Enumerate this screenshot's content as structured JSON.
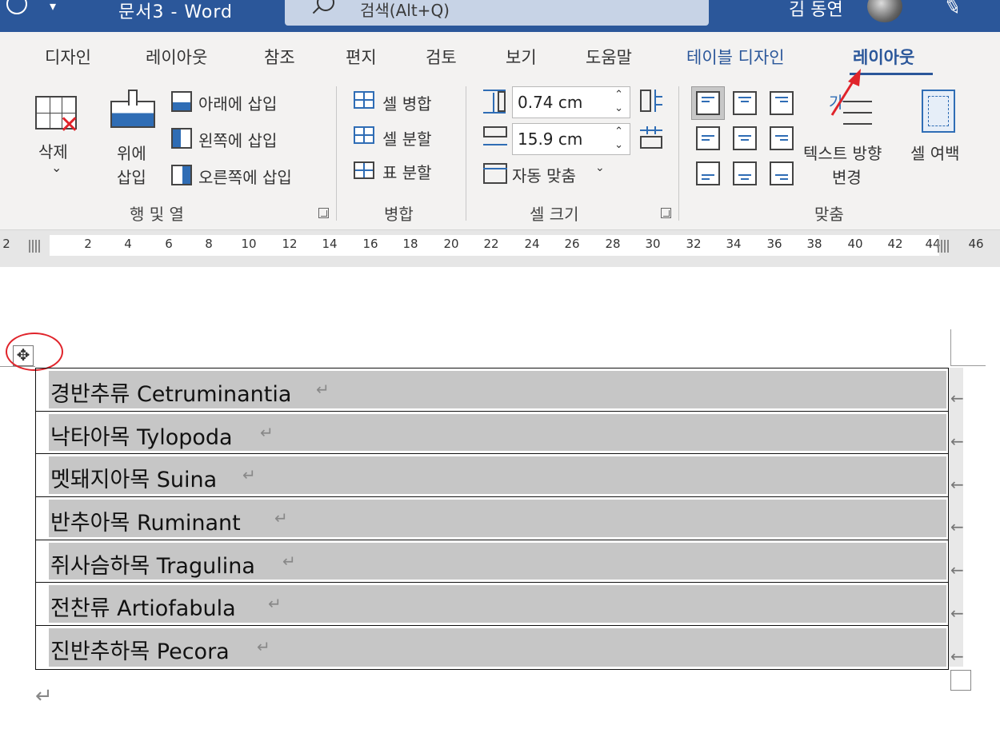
{
  "titlebar": {
    "qa": "▾",
    "title": "문서3  -  Word",
    "search_placeholder": "검색(Alt+Q)",
    "user": "김 동연"
  },
  "tabs": [
    {
      "label": "디자인"
    },
    {
      "label": "레이아웃"
    },
    {
      "label": "참조"
    },
    {
      "label": "편지"
    },
    {
      "label": "검토"
    },
    {
      "label": "보기"
    },
    {
      "label": "도움말"
    },
    {
      "label": "테이블 디자인"
    },
    {
      "label": "레이아웃"
    }
  ],
  "ribbon": {
    "delete_label": "삭제",
    "delete_arrow": "⌄",
    "insert_above_line1": "위에",
    "insert_above_line2": "삽입",
    "insert_below": "아래에 삽입",
    "insert_left": "왼쪽에 삽입",
    "insert_right": "오른쪽에 삽입",
    "group_rows_cols": "행 및 열",
    "merge_cells": "셀 병합",
    "split_cells": "셀 분할",
    "split_table": "표 분할",
    "group_merge": "병합",
    "height_value": "0.74 cm",
    "width_value": "15.9 cm",
    "autofit": "자동 맞춤",
    "autofit_arrow": "⌄",
    "group_cell_size": "셀 크기",
    "text_dir_icon": "가",
    "text_direction_line1": "텍스트 방향",
    "text_direction_line2": "변경",
    "cell_margins": "셀 여백",
    "group_alignment": "맞춤"
  },
  "ruler": {
    "left_num": "2",
    "ticks": [
      "2",
      "4",
      "6",
      "8",
      "10",
      "12",
      "14",
      "16",
      "18",
      "20",
      "22",
      "24",
      "26",
      "28",
      "30",
      "32",
      "34",
      "36",
      "38",
      "40",
      "42",
      "44",
      "46"
    ]
  },
  "document": {
    "move_handle": "✥",
    "rows": [
      {
        "text": "경반추류  Cetruminantia",
        "cr": "↵"
      },
      {
        "text": "낙타아목  Tylopoda",
        "cr": "↵"
      },
      {
        "text": "멧돼지아목  Suina",
        "cr": "↵"
      },
      {
        "text": "반추아목  Ruminant ",
        "cr": "↵"
      },
      {
        "text": "쥐사슴하목  Tragulina",
        "cr": "↵"
      },
      {
        "text": "전찬류  Artiofabula ",
        "cr": "↵"
      },
      {
        "text": "진반추하목  Pecora",
        "cr": "↵"
      }
    ],
    "row_end_mark": "←",
    "para_mark": "↵"
  },
  "colors": {
    "word_blue": "#2b579a",
    "accent_blue": "#2f6db5",
    "annotation_red": "#e0242b"
  }
}
